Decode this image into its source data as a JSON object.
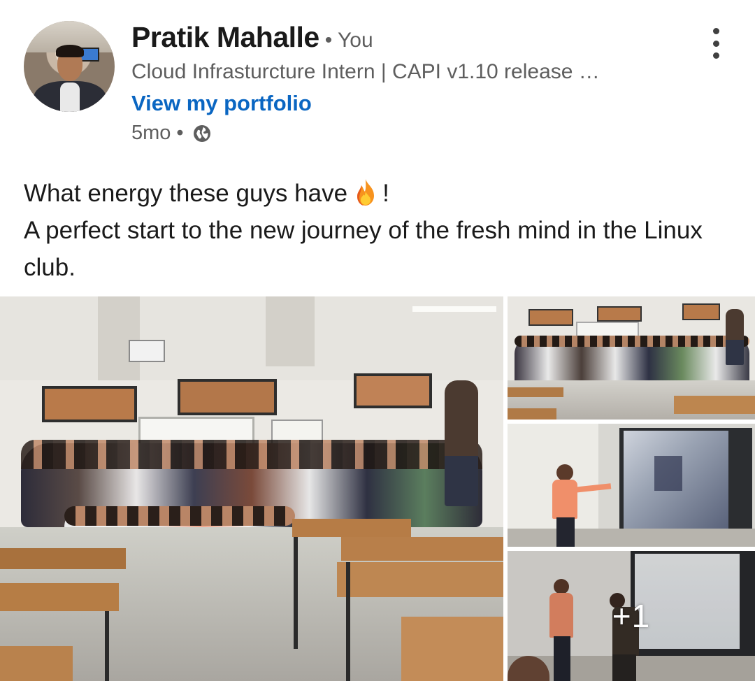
{
  "author": {
    "name": "Pratik Mahalle",
    "relation": "• You",
    "headline": "Cloud Infrasturcture Intern | CAPI v1.10 release …",
    "link_label": "View my portfolio",
    "time": "5mo",
    "separator": "•",
    "visibility_icon": "globe-icon"
  },
  "menu_icon": "more-vertical-icon",
  "post": {
    "line1_before": "What energy these guys have",
    "line1_emoji": "fire-emoji",
    "line1_after": "!",
    "line2": "A perfect start to the new journey of the fresh mind in the Linux club."
  },
  "gallery": {
    "images": [
      {
        "description": "group-photo-classroom"
      },
      {
        "description": "group-photo-wide"
      },
      {
        "description": "presenter-at-projector"
      },
      {
        "description": "presenters-at-screen"
      }
    ],
    "more_count": "+1"
  },
  "colors": {
    "link": "#0a66c2",
    "secondary_text": "#5e5e5e",
    "primary_text": "#1a1a1a"
  }
}
